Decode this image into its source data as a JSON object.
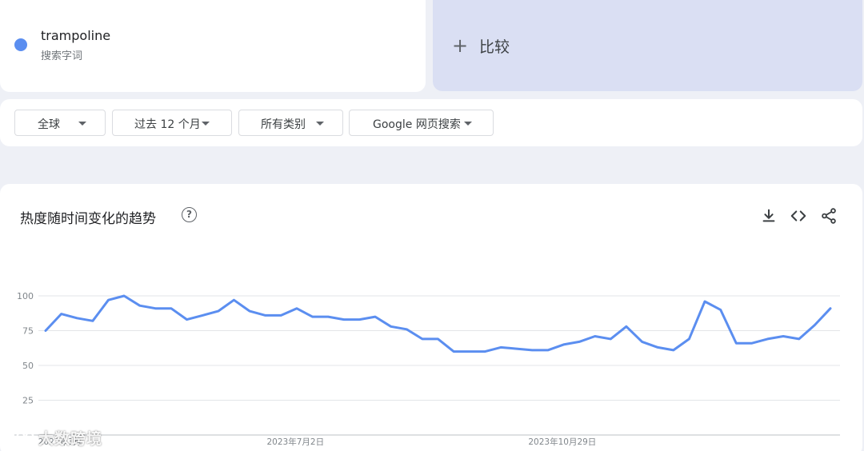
{
  "search_term": {
    "name": "trampoline",
    "type": "搜索字词",
    "color": "#5b8ef0"
  },
  "compare": {
    "plus": "+",
    "label": "比较"
  },
  "filters": {
    "region": "全球",
    "time": "过去 12 个月",
    "category": "所有类别",
    "property": "Google 网页搜索"
  },
  "chart_section": {
    "title": "热度随时间变化的趋势",
    "help_icon": "help-circle-icon",
    "download_icon": "download-icon",
    "embed_icon": "code-icon",
    "share_icon": "share-icon"
  },
  "watermark": {
    "text": "大数跨境"
  },
  "chart_data": {
    "type": "line",
    "title": "",
    "xlabel": "",
    "ylabel": "",
    "ylim": [
      0,
      100
    ],
    "grid": true,
    "yticks": [
      100,
      75,
      50,
      25
    ],
    "x_tick_labels": [
      {
        "index": 0,
        "label": "2023年3月"
      },
      {
        "index": 15,
        "label": "2023年7月2日"
      },
      {
        "index": 32,
        "label": "2023年10月29日"
      }
    ],
    "series": [
      {
        "name": "trampoline",
        "color": "#5b8ef0",
        "values": [
          75,
          87,
          84,
          82,
          97,
          100,
          93,
          91,
          91,
          83,
          86,
          89,
          97,
          89,
          86,
          86,
          91,
          85,
          85,
          83,
          83,
          85,
          78,
          76,
          69,
          69,
          60,
          60,
          60,
          63,
          62,
          61,
          61,
          65,
          67,
          71,
          69,
          78,
          67,
          63,
          61,
          69,
          96,
          90,
          66,
          66,
          69,
          71,
          69,
          79,
          91
        ]
      }
    ]
  }
}
